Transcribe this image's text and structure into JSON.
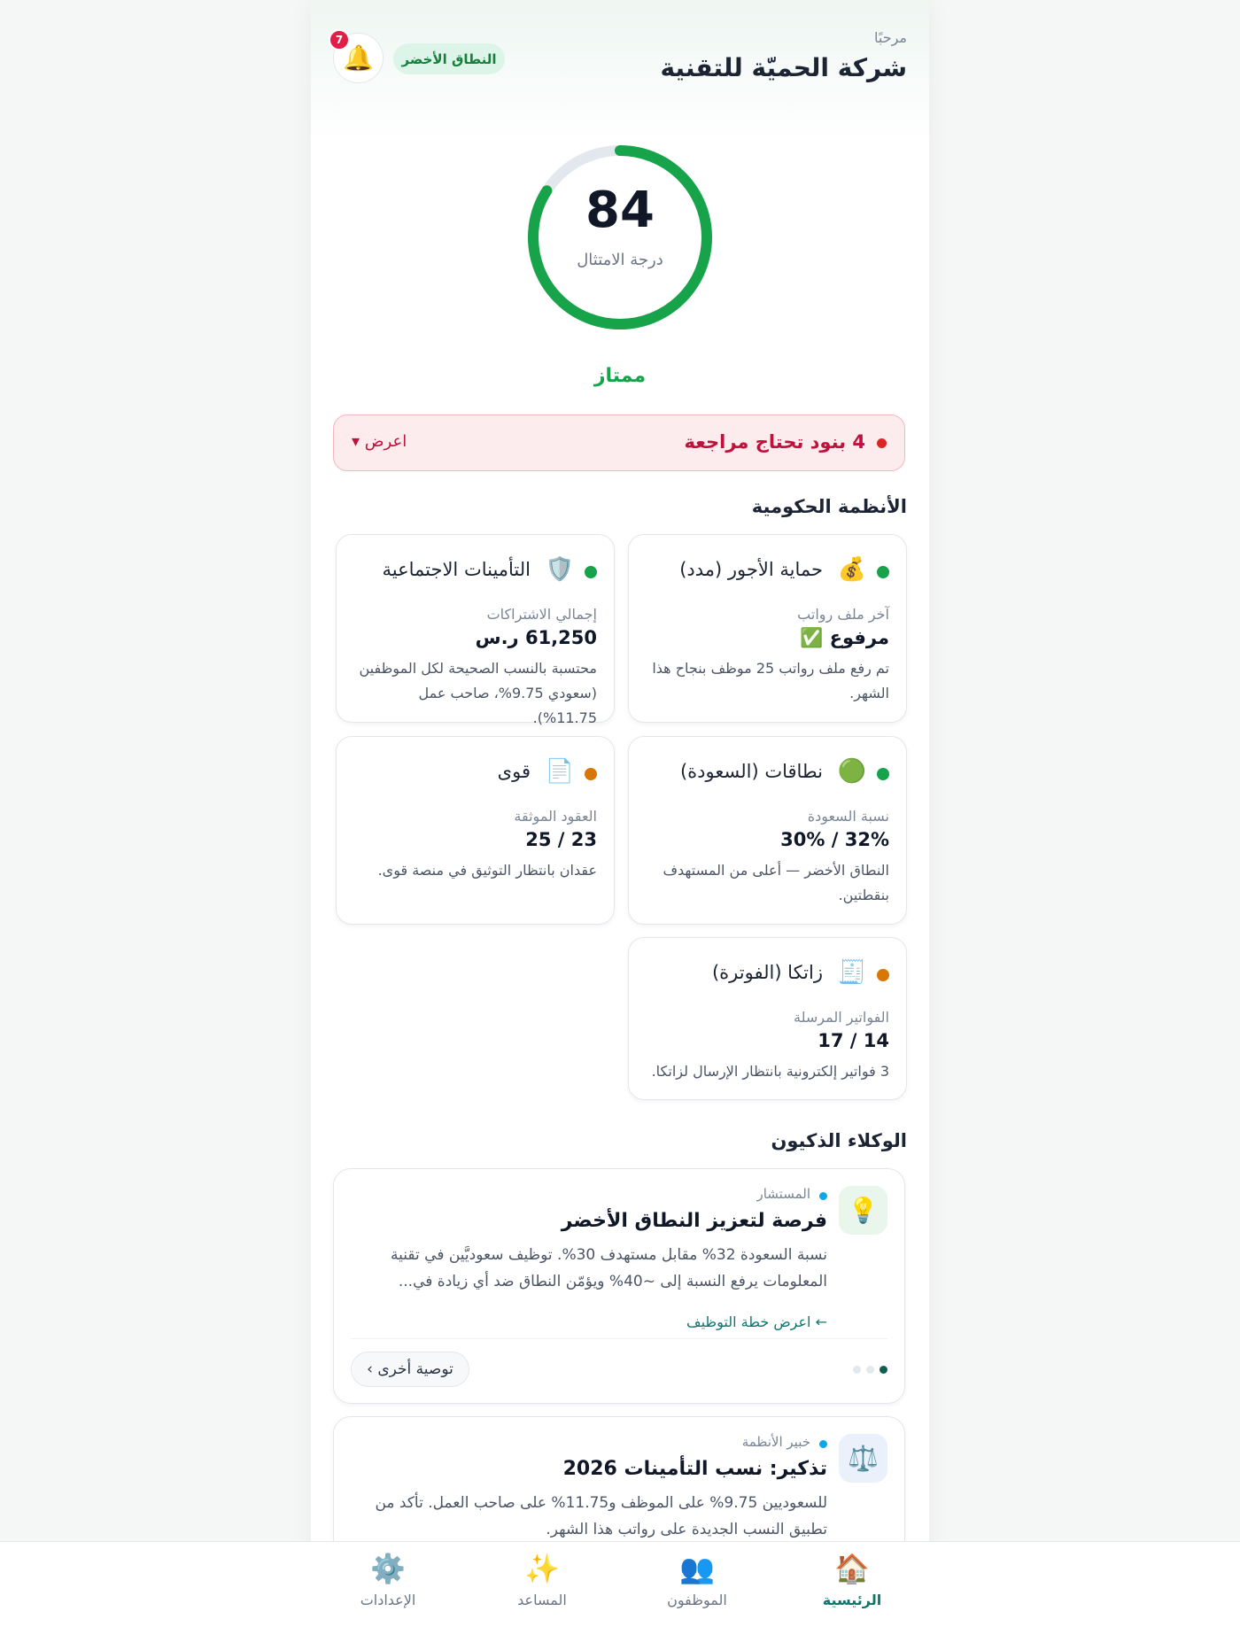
{
  "header": {
    "greeting": "مرحبًا",
    "company_name": "شركة الحميّة للتقنية",
    "band_badge": "النطاق الأخضر",
    "notification_count": "7",
    "bell_icon": "bell-icon"
  },
  "compliance": {
    "score": "84",
    "score_max": 100,
    "score_label": "درجة الامتثال",
    "rating": "ممتاز",
    "ring_color": "#16a34a",
    "track_color": "#e2e8ee"
  },
  "alert": {
    "text": "4 بنود تحتاج مراجعة",
    "toggle_label": "اعرض ▾",
    "color": "#be123c"
  },
  "government_systems": {
    "title": "الأنظمة الحكومية",
    "cards": [
      {
        "title": "حماية الأجور (مدد)",
        "icon": "💰",
        "icon_name": "money-bag-icon",
        "status": "good",
        "status_color": "#16a34a",
        "label": "آخر ملف رواتب",
        "value": "مرفوع ✅",
        "description": "تم رفع ملف رواتب 25 موظف بنجاح هذا الشهر."
      },
      {
        "title": "التأمينات الاجتماعية",
        "icon": "🛡️",
        "icon_name": "shield-icon",
        "status": "good",
        "status_color": "#16a34a",
        "label": "إجمالي الاشتراكات",
        "value": "61,250 ر.س",
        "description": "محتسبة بالنسب الصحيحة لكل الموظفين (سعودي 9.75%، صاحب عمل 11.75%)."
      },
      {
        "title": "نطاقات (السعودة)",
        "icon": "🟢",
        "icon_name": "green-circle-icon",
        "status": "good",
        "status_color": "#16a34a",
        "label": "نسبة السعودة",
        "value": "32% / 30%",
        "description": "النطاق الأخضر — أعلى من المستهدف بنقطتين."
      },
      {
        "title": "قوى",
        "icon": "📄",
        "icon_name": "document-icon",
        "status": "warning",
        "status_color": "#d97706",
        "label": "العقود الموثقة",
        "value": "23 / 25",
        "description": "عقدان بانتظار التوثيق في منصة قوى."
      },
      {
        "title": "زاتكا (الفوترة)",
        "icon": "🧾",
        "icon_name": "receipt-icon",
        "status": "warning",
        "status_color": "#d97706",
        "label": "الفواتير المرسلة",
        "value": "14 / 17",
        "description": "3 فواتير إلكترونية بانتظار الإرسال لزاتكا."
      }
    ]
  },
  "smart_agents": {
    "title": "الوكلاء الذكيون",
    "items": [
      {
        "agent": "المستشار",
        "icon": "💡",
        "icon_name": "lightbulb-icon",
        "icon_bg": "#e8f6ec",
        "title": "فرصة لتعزيز النطاق الأخضر",
        "text": "نسبة السعودة 32% مقابل مستهدف 30%. توظيف سعوديَّين في تقنية المعلومات يرفع النسبة إلى ~40% ويؤمّن النطاق ضد أي زيادة في...",
        "link": "← اعرض خطة التوظيف",
        "more_label": "توصية أخرى ›",
        "pager": [
          "active",
          "inactive",
          "inactive"
        ]
      },
      {
        "agent": "خبير الأنظمة",
        "icon": "⚖️",
        "icon_name": "scales-icon",
        "icon_bg": "#eaf1fb",
        "title": "تذكير: نسب التأمينات 2026",
        "text": "للسعوديين 9.75% على الموظف و11.75% على صاحب العمل. تأكد من تطبيق النسب الجديدة على رواتب هذا الشهر."
      }
    ]
  },
  "bottom_nav": {
    "items": [
      {
        "label": "الرئيسية",
        "icon": "🏠",
        "icon_name": "home-icon",
        "active": true
      },
      {
        "label": "الموظفون",
        "icon": "👥",
        "icon_name": "people-icon",
        "active": false
      },
      {
        "label": "المساعد",
        "icon": "✨",
        "icon_name": "sparkles-icon",
        "active": false
      },
      {
        "label": "الإعدادات",
        "icon": "⚙️",
        "icon_name": "gear-icon",
        "active": false
      }
    ]
  }
}
